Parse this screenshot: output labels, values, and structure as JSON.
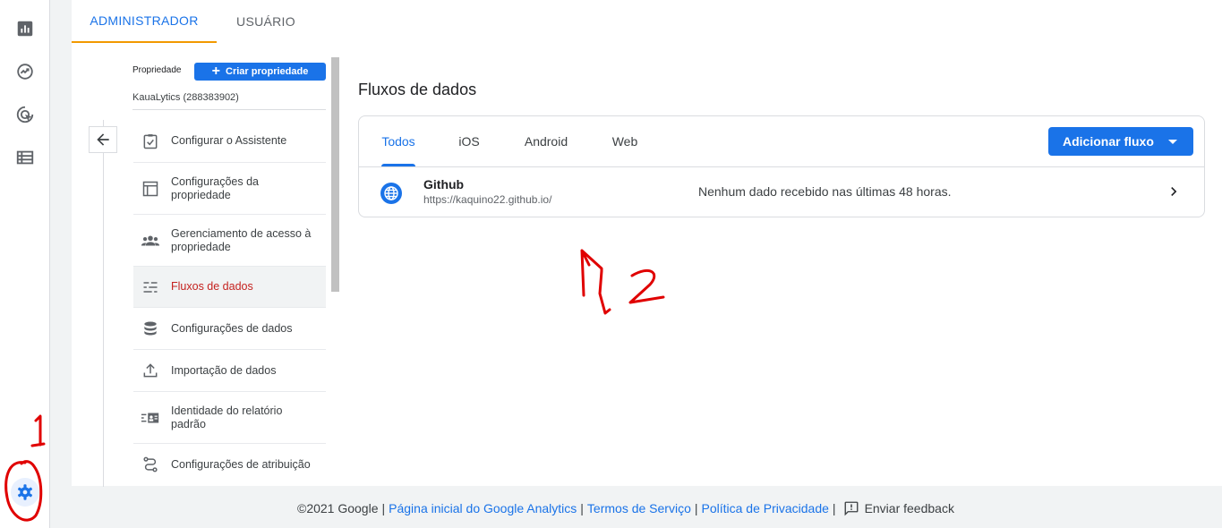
{
  "top_tabs": [
    {
      "label": "ADMINISTRADOR"
    },
    {
      "label": "USUÁRIO"
    }
  ],
  "rail": {
    "icons": [
      "bar-chart-icon",
      "explore-icon",
      "advertising-icon",
      "table-icon"
    ],
    "settings_icon": "gear-icon"
  },
  "property": {
    "label": "Propriedade",
    "create_button": "Criar propriedade",
    "name": "KauaLytics (288383902)"
  },
  "menu": [
    {
      "label": "Configurar o Assistente",
      "icon": "checklist-icon"
    },
    {
      "label": "Configurações da propriedade",
      "icon": "window-icon"
    },
    {
      "label": "Gerenciamento de acesso à propriedade",
      "icon": "people-icon"
    },
    {
      "label": "Fluxos de dados",
      "icon": "streams-icon",
      "active": true
    },
    {
      "label": "Configurações de dados",
      "icon": "database-icon"
    },
    {
      "label": "Importação de dados",
      "icon": "upload-icon"
    },
    {
      "label": "Identidade do relatório padrão",
      "icon": "id-card-icon"
    },
    {
      "label": "Configurações de atribuição",
      "icon": "route-icon"
    }
  ],
  "main": {
    "title": "Fluxos de dados",
    "tabs": [
      {
        "label": "Todos",
        "active": true
      },
      {
        "label": "iOS"
      },
      {
        "label": "Android"
      },
      {
        "label": "Web"
      }
    ],
    "add_button": "Adicionar fluxo",
    "streams": [
      {
        "name": "Github",
        "url": "https://kaquino22.github.io/",
        "status": "Nenhum dado recebido nas últimas 48 horas."
      }
    ]
  },
  "footer": {
    "copyright": "©2021 Google",
    "links": [
      "Página inicial do Google Analytics",
      "Termos de Serviço",
      "Política de Privacidade"
    ],
    "feedback": "Enviar feedback"
  },
  "colors": {
    "accent": "#1a73e8",
    "active_menu": "#c5221f",
    "tab_underline": "#f29900",
    "annotation": "#e00000"
  }
}
